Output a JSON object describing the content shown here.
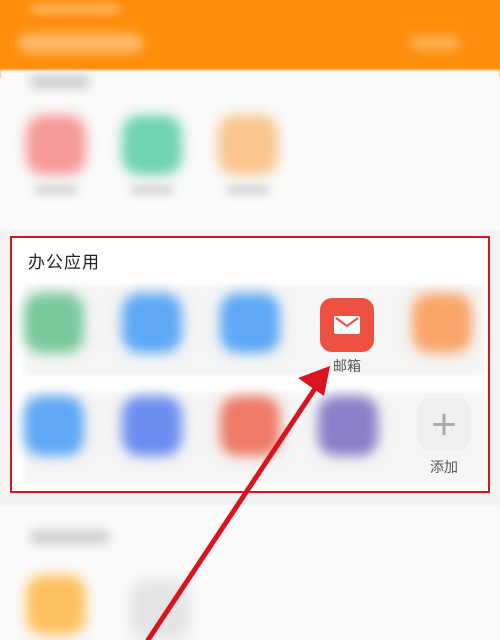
{
  "section": {
    "title": "办公应用"
  },
  "apps": {
    "mail": {
      "label": "邮箱",
      "icon": "mail-icon"
    },
    "add": {
      "label": "添加",
      "icon": "plus-icon"
    }
  },
  "colors": {
    "header": "#ff8e0d",
    "mail": "#ee5142",
    "highlight": "#d8141e"
  }
}
